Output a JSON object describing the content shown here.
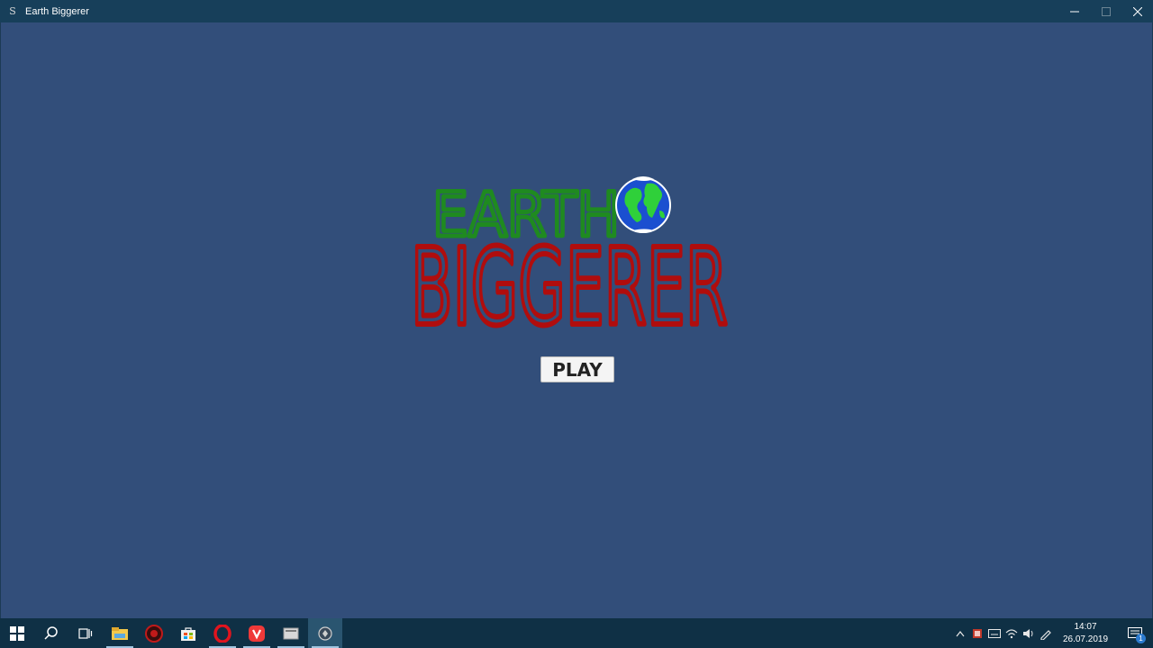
{
  "window": {
    "title": "Earth Biggerer",
    "icon_glyph": "S",
    "controls": {
      "minimize": "─",
      "maximize": "☐",
      "close": "✕"
    }
  },
  "game": {
    "logo_line1": "EARTH",
    "logo_line2": "BIGGERER",
    "play_label": "PLAY",
    "colors": {
      "background": "#324e7a",
      "earth_text": "#1f8a20",
      "biggerer_text": "#b00d0d",
      "ocean": "#1b4fd0",
      "land": "#2fd03a"
    }
  },
  "taskbar": {
    "pinned": [
      {
        "name": "start-icon",
        "running": false
      },
      {
        "name": "search-icon",
        "running": false
      },
      {
        "name": "task-view-icon",
        "running": false
      },
      {
        "name": "file-explorer-icon",
        "running": true
      },
      {
        "name": "red-app-icon",
        "running": false
      },
      {
        "name": "store-icon",
        "running": false
      },
      {
        "name": "opera-icon",
        "running": true
      },
      {
        "name": "vivaldi-icon",
        "running": true
      },
      {
        "name": "app-icon",
        "running": true
      },
      {
        "name": "game-app-icon",
        "running": true,
        "active": true
      }
    ],
    "tray": {
      "icons": [
        "chevron-up-icon",
        "tray-app-icon",
        "keyboard-icon",
        "wifi-icon",
        "volume-icon",
        "pen-icon"
      ],
      "time": "14:07",
      "date": "26.07.2019",
      "notification_count": "1"
    }
  }
}
